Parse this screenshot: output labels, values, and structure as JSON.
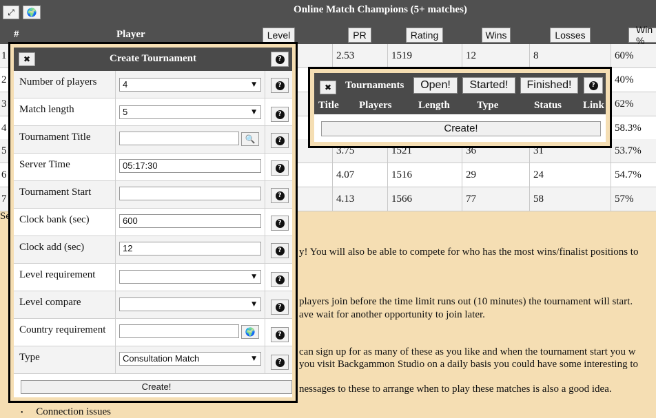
{
  "header": {
    "title": "Online Match Champions (5+ matches)",
    "expand_icon": "⤢",
    "globe_icon": "🌍",
    "col_rank": "#",
    "col_player": "Player",
    "col_level": "Level",
    "col_pr": "PR",
    "col_rating": "Rating",
    "col_wins": "Wins",
    "col_losses": "Losses",
    "col_winpct": "Win %"
  },
  "table": {
    "rows": [
      {
        "rank": "1",
        "pr": "2.53",
        "rating": "1519",
        "wins": "12",
        "losses": "8",
        "pct": "60%"
      },
      {
        "rank": "2",
        "pr": "",
        "rating": "",
        "wins": "",
        "losses": "",
        "pct": "40%"
      },
      {
        "rank": "3",
        "pr": "",
        "rating": "",
        "wins": "",
        "losses": "",
        "pct": "62%"
      },
      {
        "rank": "4",
        "pr": "",
        "rating": "",
        "wins": "",
        "losses": "",
        "pct": "58.3%"
      },
      {
        "rank": "5",
        "pr": "3.75",
        "rating": "1521",
        "wins": "36",
        "losses": "31",
        "pct": "53.7%"
      },
      {
        "rank": "6",
        "pr": "4.07",
        "rating": "1516",
        "wins": "29",
        "losses": "24",
        "pct": "54.7%"
      },
      {
        "rank": "7",
        "pr": "4.13",
        "rating": "1566",
        "wins": "77",
        "losses": "58",
        "pct": "57%"
      }
    ]
  },
  "background_text": {
    "line_se": "Se",
    "line1": "y! You will also be able to compete for who has the most wins/finalist positions to",
    "line2": "players join before the time limit runs out (10 minutes) the tournament will start.",
    "line3": "ave wait for another opportunity to join later.",
    "line4": "can sign up for as many of these as you like and when the tournament start you w",
    "line5": "you visit Backgammon Studio on a daily basis you could have some interesting to",
    "line6": "nessages to these to arrange when to play these matches is also a good idea.",
    "line7": "Connection issues"
  },
  "create_dialog": {
    "title": "Create Tournament",
    "close_icon": "✖",
    "help_icon": "?",
    "fields": {
      "num_players": {
        "label": "Number of players",
        "value": "4"
      },
      "match_length": {
        "label": "Match length",
        "value": "5"
      },
      "title": {
        "label": "Tournament Title",
        "value": ""
      },
      "server_time": {
        "label": "Server Time",
        "value": "05:17:30"
      },
      "start": {
        "label": "Tournament Start",
        "value": ""
      },
      "clock_bank": {
        "label": "Clock bank (sec)",
        "value": "600"
      },
      "clock_add": {
        "label": "Clock add (sec)",
        "value": "12"
      },
      "level_req": {
        "label": "Level requirement",
        "value": ""
      },
      "level_cmp": {
        "label": "Level compare",
        "value": ""
      },
      "country_req": {
        "label": "Country requirement",
        "value": ""
      },
      "type": {
        "label": "Type",
        "value": "Consultation Match"
      }
    },
    "search_icon": "🔍",
    "globe_icon": "🌍",
    "dropdown_arrow": "▼",
    "submit_label": "Create!"
  },
  "tournaments_panel": {
    "title": "Tournaments",
    "close_icon": "✖",
    "tab_open": "Open!",
    "tab_started": "Started!",
    "tab_finished": "Finished!",
    "help_icon": "?",
    "col_title": "Title",
    "col_players": "Players",
    "col_length": "Length",
    "col_type": "Type",
    "col_status": "Status",
    "col_link": "Link",
    "create_label": "Create!"
  }
}
